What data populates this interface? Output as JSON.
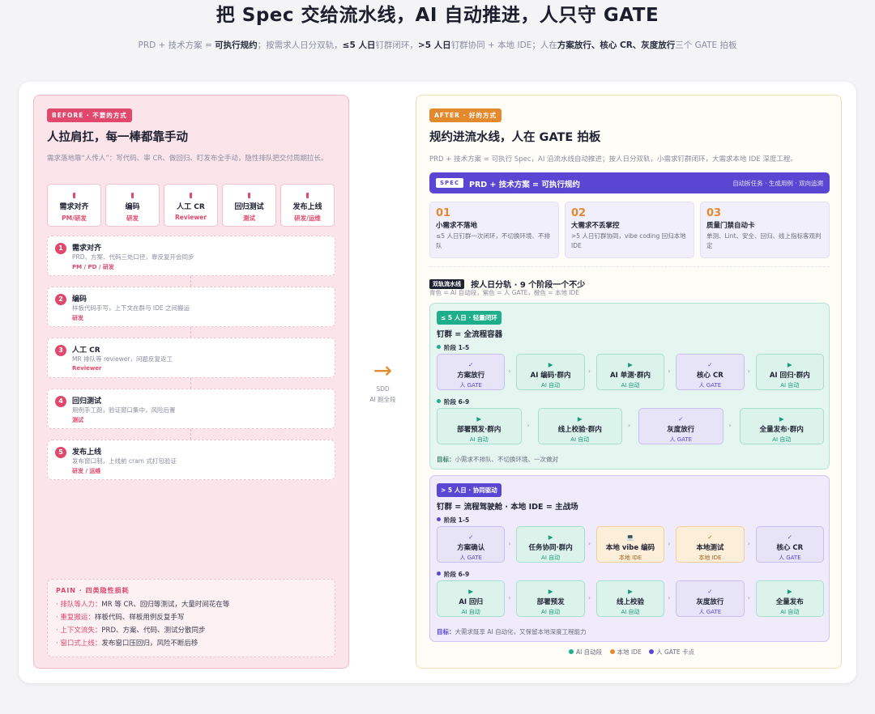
{
  "header": {
    "title": "把 Spec 交给流水线，AI 自动推进，人只守 GATE",
    "sub": [
      "PRD + 技术方案 = ",
      "可执行规约",
      "；按需求人日分双轨，",
      "≤5 人日",
      "钉群闭环，",
      ">5 人日",
      "钉群协同 + 本地 IDE；人在",
      "方案放行、核心 CR、灰度放行",
      "三个 GATE 拍板"
    ]
  },
  "before": {
    "tag": "BEFORE · 不要的方式",
    "title": "人拉肩扛，每一棒都靠手动",
    "desc": "需求落地靠“人传人”：写代码、审 CR、做回归、盯发布全手动，隐性排队把交付周期拉长。",
    "steps": [
      {
        "t": "需求对齐",
        "r": "PM/研发"
      },
      {
        "t": "编码",
        "r": "研发"
      },
      {
        "t": "人工 CR",
        "r": "Reviewer"
      },
      {
        "t": "回归测试",
        "r": "测试"
      },
      {
        "t": "发布上线",
        "r": "研发/运维"
      }
    ],
    "rows": [
      {
        "n": "1",
        "t": "需求对齐",
        "d": "PRD、方案、代码三处口径，靠反复开会同步",
        "r": "PM / PD / 研发"
      },
      {
        "n": "2",
        "t": "编码",
        "d": "样板代码手写，上下文在群与 IDE 之间搬运",
        "r": "研发"
      },
      {
        "n": "3",
        "t": "人工 CR",
        "d": "MR 排队等 reviewer，问题反复返工",
        "r": "Reviewer"
      },
      {
        "n": "4",
        "t": "回归测试",
        "d": "用例手工跑，验证窗口集中，风险后置",
        "r": "测试"
      },
      {
        "n": "5",
        "t": "发布上线",
        "d": "发布窗口制，上线前 cram 式打包验证",
        "r": "研发 / 运维"
      }
    ],
    "pain": {
      "h": "PAIN · 四类隐性损耗",
      "items": [
        {
          "k": "· 排队等人力：",
          "v": "MR 等 CR、回归等测试，大量时间花在等"
        },
        {
          "k": "· 重复搬运：",
          "v": "样板代码、样板用例反复手写"
        },
        {
          "k": "· 上下文流失：",
          "v": "PRD、方案、代码、测试分散同步"
        },
        {
          "k": "· 窗口式上线：",
          "v": "发布窗口压回归，风险不断后移"
        }
      ]
    }
  },
  "arrow": {
    "icon": "→",
    "l1": "SDD",
    "l2": "AI 跑全段"
  },
  "after": {
    "tag": "AFTER · 好的方式",
    "title": "规约进流水线，人在 GATE 拍板",
    "desc": "PRD + 技术方案 = 可执行 Spec，AI 沿流水线自动推进；按人日分双轨，小需求钉群闭环，大需求本地 IDE 深度工程。",
    "spec": {
      "tag": "SPEC",
      "t": "PRD + 技术方案 = 可执行规约",
      "r": "自动拆任务 · 生成用例 · 双向追溯"
    },
    "points": [
      {
        "n": "01",
        "t": "小需求不落地",
        "d": "≤5 人日钉群一次闭环，不切换环境、不排队"
      },
      {
        "n": "02",
        "t": "大需求不丢掌控",
        "d": ">5 人日钉群协同，vibe coding 回归本地 IDE"
      },
      {
        "n": "03",
        "t": "质量门禁自动卡",
        "d": "单测、Lint、安全、回归、线上指标客观判定"
      }
    ],
    "lanes_tag": "双轨流水线",
    "lanes_title": "按人日分轨 · 9 个阶段一个不少",
    "lanes_sub": "青色 = AI 自动段，紫色 = 人 GATE，橙色 = 本地 IDE",
    "lane1": {
      "tag": "≤ 5 人日 · 轻量闭环",
      "h": "钉群 = 全流程容器",
      "p1": "阶段 1-5",
      "p2": "阶段 6-9",
      "goal_k": "目标：",
      "goal": "小需求不排队、不切换环境、一次做对",
      "r1": [
        {
          "ic": "✓",
          "t": "方案放行",
          "s": "人 GATE",
          "k": "gt"
        },
        {
          "ic": "▶",
          "t": "AI 编码·群内",
          "s": "AI 自动",
          "k": "gt"
        },
        {
          "ic": "▶",
          "t": "AI 单测·群内",
          "s": "AI 自动",
          "k": "ai"
        },
        {
          "ic": "✓",
          "t": "核心 CR",
          "s": "人 GATE",
          "k": "gt"
        },
        {
          "ic": "▶",
          "t": "AI 回归·群内",
          "s": "AI 自动",
          "k": "ai"
        }
      ],
      "r2": [
        {
          "ic": "▶",
          "t": "部署预发·群内",
          "s": "AI 自动",
          "k": "ai"
        },
        {
          "ic": "▶",
          "t": "线上校验·群内",
          "s": "AI 自动",
          "k": "ai"
        },
        {
          "ic": "✓",
          "t": "灰度放行",
          "s": "人 GATE",
          "k": "gt"
        },
        {
          "ic": "▶",
          "t": "全量发布·群内",
          "s": "AI 自动",
          "k": "ai"
        }
      ]
    },
    "lane2": {
      "tag": "> 5 人日 · 协同驱动",
      "h": "钉群 = 流程驾驶舱 · 本地 IDE = 主战场",
      "p1": "阶段 1-5",
      "p2": "阶段 6-9",
      "goal_k": "目标：",
      "goal": "大需求既享 AI 自动化，又保留本地深度工程能力",
      "r1": [
        {
          "ic": "✓",
          "t": "方案确认",
          "s": "人 GATE",
          "k": "gt"
        },
        {
          "ic": "▶",
          "t": "任务协同·群内",
          "s": "AI 自动",
          "k": "ai"
        },
        {
          "ic": "💻",
          "t": "本地 vibe 编码",
          "s": "本地 IDE",
          "k": "ld"
        },
        {
          "ic": "✓",
          "t": "本地测试",
          "s": "本地 IDE",
          "k": "ld"
        },
        {
          "ic": "✓",
          "t": "核心 CR",
          "s": "人 GATE",
          "k": "gt"
        }
      ],
      "r2": [
        {
          "ic": "▶",
          "t": "AI 回归",
          "s": "AI 自动",
          "k": "ai"
        },
        {
          "ic": "▶",
          "t": "部署预发",
          "s": "AI 自动",
          "k": "ai"
        },
        {
          "ic": "▶",
          "t": "线上校验",
          "s": "AI 自动",
          "k": "ai"
        },
        {
          "ic": "✓",
          "t": "灰度放行",
          "s": "人 GATE",
          "k": "gt"
        },
        {
          "ic": "▶",
          "t": "全量发布",
          "s": "AI 自动",
          "k": "ai"
        }
      ]
    },
    "legend": [
      "AI 自动段",
      "本地 IDE",
      "人 GATE 卡点"
    ]
  },
  "colors": {
    "pink": "#e0486c",
    "orange": "#e48a2e",
    "purple": "#5946d2",
    "teal": "#1fae8a"
  }
}
